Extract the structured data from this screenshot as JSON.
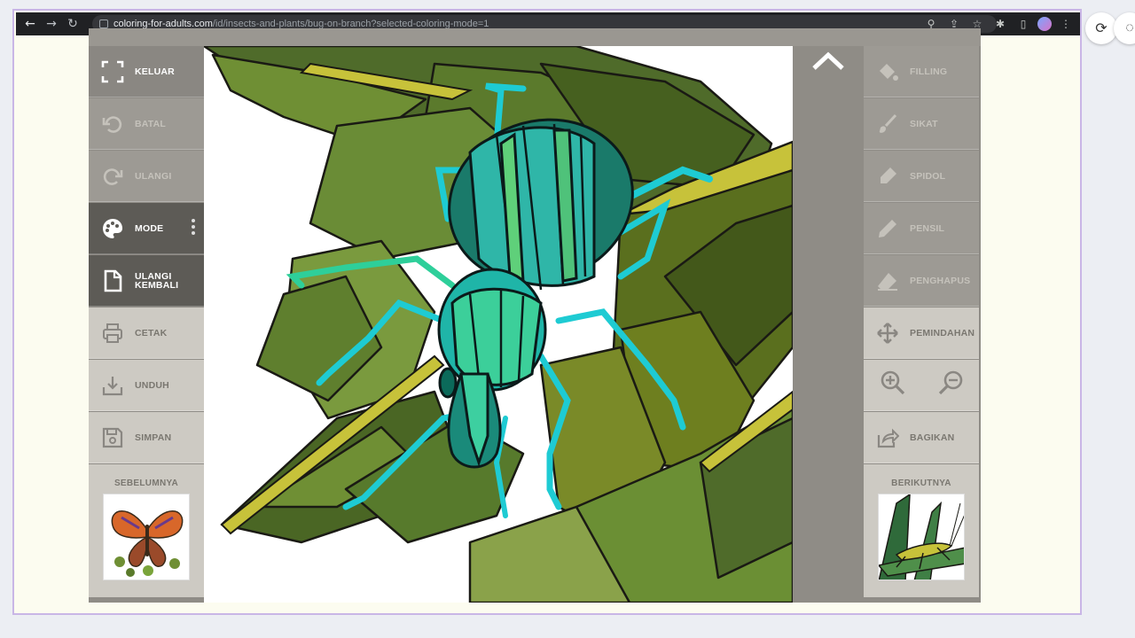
{
  "browser": {
    "url_domain": "coloring-for-adults.com",
    "url_path": "/id/insects-and-plants/bug-on-branch?selected-coloring-mode=1"
  },
  "left_tools": [
    {
      "key": "exit",
      "label": "KELUAR",
      "icon": "fullscreen-exit-icon",
      "state": "dark"
    },
    {
      "key": "undo",
      "label": "BATAL",
      "icon": "undo-icon",
      "state": "disabled"
    },
    {
      "key": "redo",
      "label": "ULANGI",
      "icon": "redo-icon",
      "state": "disabled"
    },
    {
      "key": "mode",
      "label": "MODE",
      "icon": "palette-icon",
      "state": "active"
    },
    {
      "key": "restart",
      "label": "ULANGI KEMBALI",
      "label_line1": "ULANGI",
      "label_line2": "KEMBALI",
      "icon": "page-icon",
      "state": "active"
    },
    {
      "key": "print",
      "label": "CETAK",
      "icon": "printer-icon",
      "state": "light"
    },
    {
      "key": "download",
      "label": "UNDUH",
      "icon": "download-icon",
      "state": "light"
    },
    {
      "key": "save",
      "label": "SIMPAN",
      "icon": "floppy-icon",
      "state": "light"
    }
  ],
  "right_tools": [
    {
      "key": "fill",
      "label": "FILLING",
      "icon": "paint-bucket-icon",
      "state": "disabled"
    },
    {
      "key": "brush",
      "label": "SIKAT",
      "icon": "brush-icon",
      "state": "disabled"
    },
    {
      "key": "marker",
      "label": "SPIDOL",
      "icon": "marker-icon",
      "state": "disabled"
    },
    {
      "key": "pencil",
      "label": "PENSIL",
      "icon": "pencil-icon",
      "state": "disabled"
    },
    {
      "key": "eraser",
      "label": "PENGHAPUS",
      "icon": "eraser-icon",
      "state": "disabled"
    },
    {
      "key": "move",
      "label": "PEMINDAHAN",
      "icon": "move-icon",
      "state": "light"
    },
    {
      "key": "share",
      "label": "BAGIKAN",
      "icon": "share-icon",
      "state": "light"
    }
  ],
  "prev": {
    "label": "SEBELUMNYA",
    "thumb": "butterfly-thumbnail"
  },
  "next": {
    "label": "BERIKUTNYA",
    "thumb": "grasshopper-thumbnail"
  },
  "colors": {
    "sidebar_dark": "#8a8782",
    "sidebar_active": "#5d5b56",
    "sidebar_light": "#cdcac3",
    "leaf_dark": "#4f6b2a",
    "leaf_mid": "#6f8f34",
    "beetle_teal": "#1fb5a8",
    "beetle_leg": "#1ecbd3"
  }
}
